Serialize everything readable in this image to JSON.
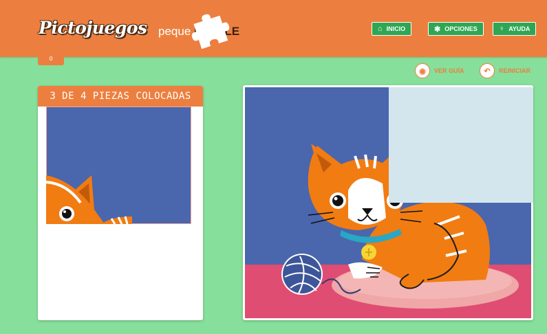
{
  "header": {
    "logo": "Pictojuegos",
    "sub_logo_prefix": "peque",
    "sub_logo_main": "PUZZLE",
    "nav": [
      {
        "label": "INICIO",
        "icon": "home-icon"
      },
      {
        "label": "OPCIONES",
        "icon": "gear-icon"
      },
      {
        "label": "AYUDA",
        "icon": "lightbulb-icon"
      }
    ],
    "tab_stub": "0"
  },
  "tools": {
    "guide_label": "VER GUÍA",
    "guide_icon": "eye-icon",
    "reset_label": "REINICIAR",
    "reset_icon": "undo-icon"
  },
  "pieces_panel": {
    "title": "3 DE 4 PIEZAS COLOCADAS"
  },
  "colors": {
    "background": "#86df9a",
    "header": "#ec7f3f",
    "nav_button": "#2fa653",
    "puzzle_bg": "#4a66ad",
    "cat_orange": "#f17c12",
    "floor": "#e04d72",
    "empty_slot": "#d3e6ee"
  }
}
